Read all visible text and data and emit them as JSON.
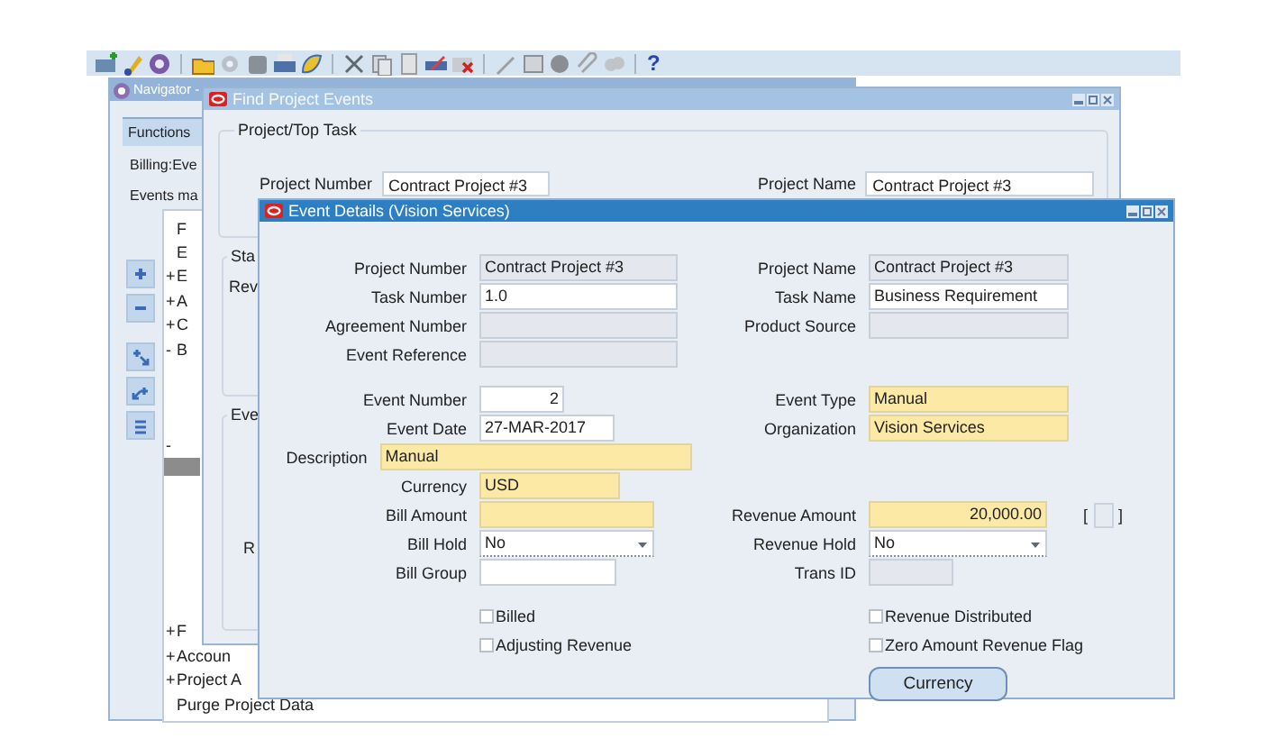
{
  "toolbar": {
    "help": "?"
  },
  "navigator": {
    "title": "Navigator -",
    "tab": {
      "label": "Functions",
      "selected": true
    },
    "lines": [
      "Billing:Eve",
      "Events ma"
    ],
    "tree": [
      {
        "label": "F",
        "selected": false
      },
      {
        "label": "E",
        "selected": false
      },
      {
        "marker": "+",
        "label": "E",
        "selected": false
      },
      {
        "marker": "+",
        "label": "A",
        "selected": false
      },
      {
        "marker": "+",
        "label": "C",
        "selected": false
      },
      {
        "marker": "-",
        "label": "B",
        "selected": false
      },
      {
        "marker": "-",
        "selected": false
      },
      {
        "selected": true
      },
      {
        "marker": "+",
        "label": "F",
        "selected": false
      },
      {
        "marker": "+",
        "label": "Accoun",
        "selected": false
      },
      {
        "marker": "+",
        "label": "Project A",
        "selected": false
      },
      {
        "label": "Purge Project Data",
        "selected": false
      }
    ]
  },
  "find_window": {
    "title": "Find Project Events",
    "group": "Project/Top Task",
    "fields": [
      {
        "label": "Project Number",
        "value": "Contract Project #3"
      },
      {
        "label": "Project Name",
        "value": "Contract Project #3"
      }
    ],
    "fragments": [
      {
        "legend": "Sta",
        "line": "Rev"
      },
      {
        "legend": "Eve",
        "line": "R"
      }
    ]
  },
  "event_window": {
    "title": "Event Details (Vision Services)",
    "sections": [
      [
        [
          {
            "label": "Project Number",
            "kind": "readonly",
            "value": "Contract Project #3"
          },
          {
            "label": "Project Name",
            "kind": "readonly",
            "value": "Contract Project #3"
          }
        ],
        [
          {
            "label": "Task Number",
            "kind": "text",
            "value": "1.0"
          },
          {
            "label": "Task Name",
            "kind": "text",
            "value": "Business Requirement"
          }
        ],
        [
          {
            "label": "Agreement Number",
            "kind": "readonly"
          },
          {
            "label": "Product Source",
            "kind": "readonly"
          }
        ],
        [
          {
            "label": "Event Reference",
            "kind": "readonly"
          }
        ]
      ],
      [
        [
          {
            "label": "Event Number",
            "kind": "text",
            "numeric": true,
            "value": "2"
          },
          {
            "label": "Event Type",
            "kind": "required",
            "value": "Manual"
          }
        ],
        [
          {
            "label": "Event Date",
            "kind": "text",
            "value": "27-MAR-2017"
          },
          {
            "label": "Organization",
            "kind": "required",
            "value": "Vision Services"
          }
        ],
        [
          {
            "label": "Description",
            "kind": "required",
            "value": "Manual"
          }
        ],
        [
          {
            "label": "Currency",
            "kind": "required",
            "value": "USD"
          }
        ],
        [
          {
            "label": "Bill Amount",
            "kind": "required"
          },
          {
            "label": "Revenue Amount",
            "kind": "required",
            "numeric": true,
            "value": "20,000.00",
            "bracket": [
              "[",
              "]"
            ]
          }
        ],
        [
          {
            "label": "Bill Hold",
            "kind": "select",
            "value": "No"
          },
          {
            "label": "Revenue Hold",
            "kind": "select",
            "value": "No"
          }
        ],
        [
          {
            "label": "Bill Group",
            "kind": "text"
          },
          {
            "label": "Trans ID",
            "kind": "readonly"
          }
        ]
      ]
    ],
    "checkboxes": [
      [
        {
          "label": "Billed",
          "checked": false
        },
        {
          "label": "Revenue Distributed",
          "checked": false
        }
      ],
      [
        {
          "label": "Adjusting Revenue",
          "checked": false
        },
        {
          "label": "Zero Amount Revenue Flag",
          "checked": false
        }
      ]
    ],
    "button": "Currency"
  }
}
